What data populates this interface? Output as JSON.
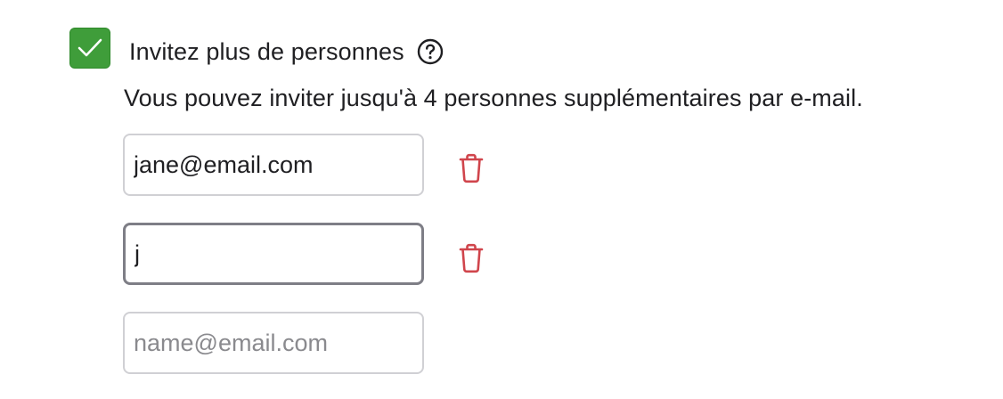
{
  "invite": {
    "checkbox": {
      "checked": true,
      "color": "#3f9d3a"
    },
    "title": "Invitez plus de personnes",
    "help_icon": "question-circle-icon",
    "description": "Vous pouvez inviter jusqu'à 4 personnes supplémentaires par e-mail.",
    "emails": [
      {
        "value": "jane@email.com",
        "placeholder": ""
      },
      {
        "value": "j",
        "placeholder": ""
      },
      {
        "value": "",
        "placeholder": "name@email.com"
      }
    ],
    "delete_icon": "trash-icon",
    "delete_color": "#d0454c"
  }
}
